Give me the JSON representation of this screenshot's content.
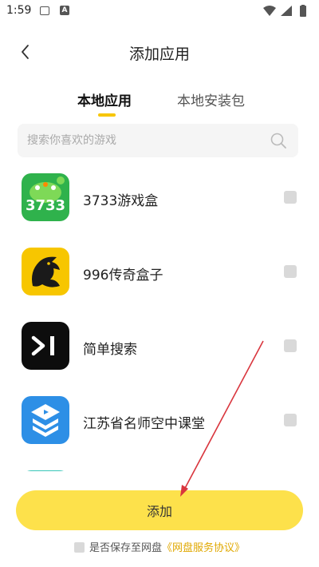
{
  "status_bar": {
    "time": "1:59"
  },
  "header": {
    "title": "添加应用"
  },
  "tabs": [
    {
      "label": "本地应用",
      "active": true
    },
    {
      "label": "本地安装包",
      "active": false
    }
  ],
  "search": {
    "placeholder": "搜索你喜欢的游戏",
    "value": ""
  },
  "apps": [
    {
      "name": "3733游戏盒",
      "icon": "3733-logo-icon",
      "icon_text": "3733",
      "checked": false
    },
    {
      "name": "996传奇盒子",
      "icon": "dragon-logo-icon",
      "checked": false
    },
    {
      "name": "简单搜索",
      "icon": "simple-search-logo-icon",
      "checked": false
    },
    {
      "name": "江苏省名师空中课堂",
      "icon": "classroom-logo-icon",
      "checked": false
    }
  ],
  "footer": {
    "add_label": "添加",
    "save_text": "是否保存至网盘",
    "agreement_text": "《网盘服务协议》"
  },
  "colors": {
    "accent": "#f7c600",
    "button": "#fde14b",
    "link": "#e0a800",
    "annotation_arrow": "#d9363e"
  }
}
